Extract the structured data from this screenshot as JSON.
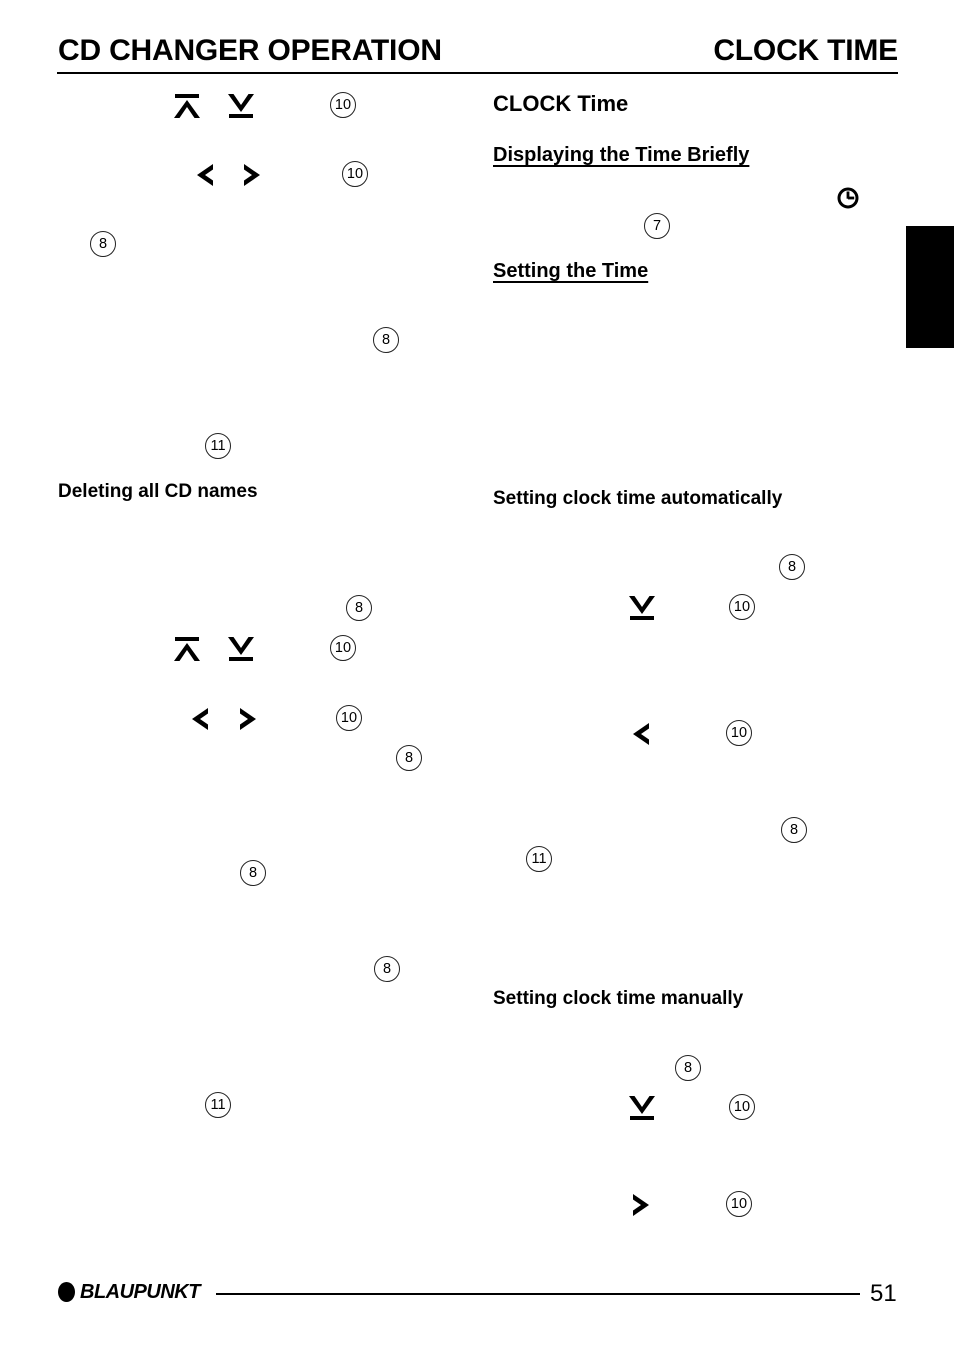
{
  "page": {
    "header": {
      "left_title": "CD CHANGER OPERATION",
      "right_title": "CLOCK TIME"
    },
    "footer": {
      "brand": "BLAUPUNKT",
      "page_number": "51"
    }
  },
  "left_column": {
    "headings": [
      {
        "text": "Deleting all CD names"
      }
    ],
    "glyphs": [
      {
        "name": "up-arrow-bar-glyph",
        "symbol": "up-bar"
      },
      {
        "name": "down-arrow-bar-glyph",
        "symbol": "down-bar"
      },
      {
        "name": "left-chevron-glyph",
        "symbol": "left"
      },
      {
        "name": "right-chevron-glyph",
        "symbol": "right"
      },
      {
        "name": "up-arrow-bar-glyph",
        "symbol": "up-bar"
      },
      {
        "name": "down-arrow-bar-glyph",
        "symbol": "down-bar"
      },
      {
        "name": "left-chevron-glyph",
        "symbol": "left"
      },
      {
        "name": "right-chevron-glyph",
        "symbol": "right"
      }
    ],
    "callouts": [
      {
        "label": "10"
      },
      {
        "label": "10"
      },
      {
        "label": "8"
      },
      {
        "label": "8"
      },
      {
        "label": "11"
      },
      {
        "label": "8"
      },
      {
        "label": "10"
      },
      {
        "label": "10"
      },
      {
        "label": "8"
      },
      {
        "label": "8"
      },
      {
        "label": "8"
      },
      {
        "label": "11"
      }
    ]
  },
  "right_column": {
    "section_title": "CLOCK Time",
    "subheadings": [
      {
        "text": "Displaying the Time Briefly"
      },
      {
        "text": "Setting the Time"
      }
    ],
    "headings": [
      {
        "text": "Setting clock time automatically"
      },
      {
        "text": "Setting clock time manually"
      }
    ],
    "icons": [
      {
        "name": "clock-icon"
      }
    ],
    "glyphs": [
      {
        "name": "down-arrow-bar-glyph",
        "symbol": "down-bar"
      },
      {
        "name": "left-chevron-glyph",
        "symbol": "left"
      },
      {
        "name": "down-arrow-bar-glyph",
        "symbol": "down-bar"
      },
      {
        "name": "right-chevron-glyph",
        "symbol": "right"
      }
    ],
    "callouts": [
      {
        "label": "7"
      },
      {
        "label": "8"
      },
      {
        "label": "10"
      },
      {
        "label": "10"
      },
      {
        "label": "8"
      },
      {
        "label": "11"
      },
      {
        "label": "8"
      },
      {
        "label": "10"
      },
      {
        "label": "10"
      }
    ]
  },
  "side_tab": {
    "color": "#000000"
  }
}
